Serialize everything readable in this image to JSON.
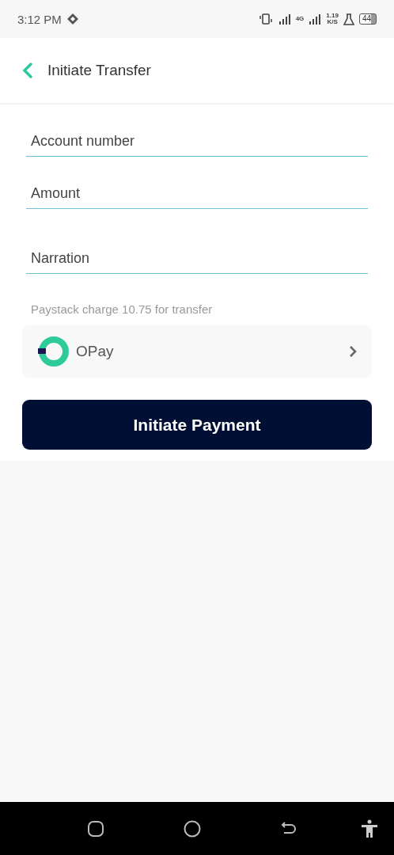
{
  "status_bar": {
    "time": "3:12 PM",
    "network": "4G",
    "speed": "1.19",
    "speed_unit": "K/S",
    "battery": "44"
  },
  "header": {
    "title": "Initiate Transfer"
  },
  "fields": [
    {
      "placeholder": "Account number"
    },
    {
      "placeholder": "Amount"
    },
    {
      "placeholder": "Narration"
    }
  ],
  "charge_note": "Paystack charge 10.75 for transfer",
  "bank": {
    "name": "OPay"
  },
  "submit": "Initiate Payment"
}
